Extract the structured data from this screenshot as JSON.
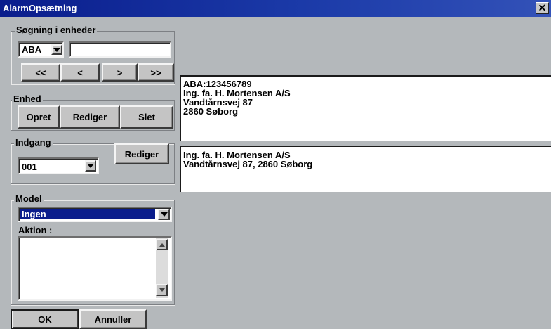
{
  "window": {
    "title": "AlarmOpsætning",
    "close_label": "✕"
  },
  "search_group": {
    "legend": "Søgning i enheder",
    "prefix_value": "ABA",
    "search_value": "",
    "nav": {
      "first": "<<",
      "prev": "<",
      "next": ">",
      "last": ">>"
    }
  },
  "unit_group": {
    "legend": "Enhed",
    "create": "Opret",
    "edit": "Rediger",
    "delete": "Slet"
  },
  "input_group": {
    "legend": "Indgang",
    "selected": "001",
    "edit": "Rediger"
  },
  "model_group": {
    "legend": "Model",
    "selected": "Ingen",
    "action_label": "Aktion :"
  },
  "footer": {
    "ok": "OK",
    "cancel": "Annuller"
  },
  "unit_info": [
    "ABA:123456789",
    "Ing. fa. H. Mortensen A/S",
    "Vandtårnsvej 87",
    "2860 Søborg"
  ],
  "input_info": [
    "Ing. fa. H. Mortensen A/S",
    "Vandtårnsvej 87, 2860 Søborg"
  ]
}
